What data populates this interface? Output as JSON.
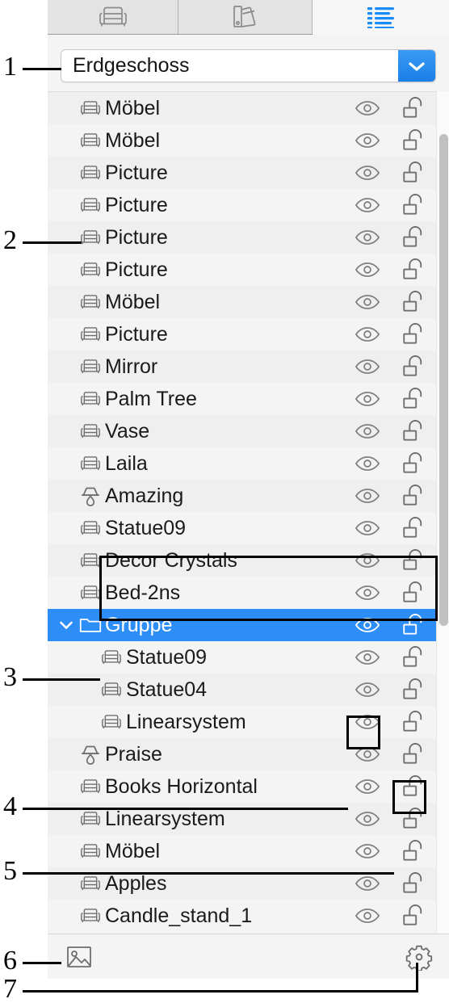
{
  "tabs": [
    {
      "name": "furniture-tab",
      "icon": "armchair-icon",
      "active": false
    },
    {
      "name": "materials-tab",
      "icon": "swatch-fan-icon",
      "active": false
    },
    {
      "name": "object-list-tab",
      "icon": "list-lines-icon",
      "active": true
    }
  ],
  "floor_selector": {
    "value": "Erdgeschoss",
    "icon": "chevron-down-icon",
    "accent": "#1a7ee8"
  },
  "list": {
    "eye_icon": "eye-icon",
    "lock_icon": "unlocked-padlock-icon",
    "folder_icon": "folder-icon",
    "expand_icon": "chevron-down-icon",
    "selection_color": "#2e8ef7",
    "items": [
      {
        "label": "Möbel",
        "icon": "armchair-icon",
        "depth": 0,
        "selected": false
      },
      {
        "label": "Möbel",
        "icon": "armchair-icon",
        "depth": 0,
        "selected": false
      },
      {
        "label": "Picture",
        "icon": "armchair-icon",
        "depth": 0,
        "selected": false
      },
      {
        "label": "Picture",
        "icon": "armchair-icon",
        "depth": 0,
        "selected": false
      },
      {
        "label": "Picture",
        "icon": "armchair-icon",
        "depth": 0,
        "selected": false
      },
      {
        "label": "Picture",
        "icon": "armchair-icon",
        "depth": 0,
        "selected": false
      },
      {
        "label": "Möbel",
        "icon": "armchair-icon",
        "depth": 0,
        "selected": false
      },
      {
        "label": "Picture",
        "icon": "armchair-icon",
        "depth": 0,
        "selected": false
      },
      {
        "label": "Mirror",
        "icon": "armchair-icon",
        "depth": 0,
        "selected": false
      },
      {
        "label": "Palm Tree",
        "icon": "armchair-icon",
        "depth": 0,
        "selected": false
      },
      {
        "label": "Vase",
        "icon": "armchair-icon",
        "depth": 0,
        "selected": false
      },
      {
        "label": "Laila",
        "icon": "armchair-icon",
        "depth": 0,
        "selected": false
      },
      {
        "label": "Amazing",
        "icon": "lamp-icon",
        "depth": 0,
        "selected": false
      },
      {
        "label": "Statue09",
        "icon": "armchair-icon",
        "depth": 0,
        "selected": false
      },
      {
        "label": "Decor Crystals",
        "icon": "armchair-icon",
        "depth": 0,
        "selected": false
      },
      {
        "label": "Bed-2ns",
        "icon": "armchair-icon",
        "depth": 0,
        "selected": false
      },
      {
        "label": "Gruppe",
        "icon": "folder-icon",
        "depth": 0,
        "selected": true,
        "expanded": true
      },
      {
        "label": "Statue09",
        "icon": "armchair-icon",
        "depth": 1,
        "selected": false
      },
      {
        "label": "Statue04",
        "icon": "armchair-icon",
        "depth": 1,
        "selected": false
      },
      {
        "label": "Linearsystem",
        "icon": "armchair-icon",
        "depth": 1,
        "selected": false
      },
      {
        "label": "Praise",
        "icon": "lamp-icon",
        "depth": 0,
        "selected": false
      },
      {
        "label": "Books Horizontal",
        "icon": "armchair-icon",
        "depth": 0,
        "selected": false
      },
      {
        "label": "Linearsystem",
        "icon": "armchair-icon",
        "depth": 0,
        "selected": false
      },
      {
        "label": "Möbel",
        "icon": "armchair-icon",
        "depth": 0,
        "selected": false
      },
      {
        "label": "Apples",
        "icon": "armchair-icon",
        "depth": 0,
        "selected": false
      },
      {
        "label": "Candle_stand_1",
        "icon": "armchair-icon",
        "depth": 0,
        "selected": false
      }
    ]
  },
  "bottom_bar": {
    "left_button_icon": "image-icon",
    "right_button_icon": "gear-icon"
  },
  "annotations": [
    {
      "number": "1"
    },
    {
      "number": "2"
    },
    {
      "number": "3"
    },
    {
      "number": "4"
    },
    {
      "number": "5"
    },
    {
      "number": "6"
    },
    {
      "number": "7"
    }
  ]
}
